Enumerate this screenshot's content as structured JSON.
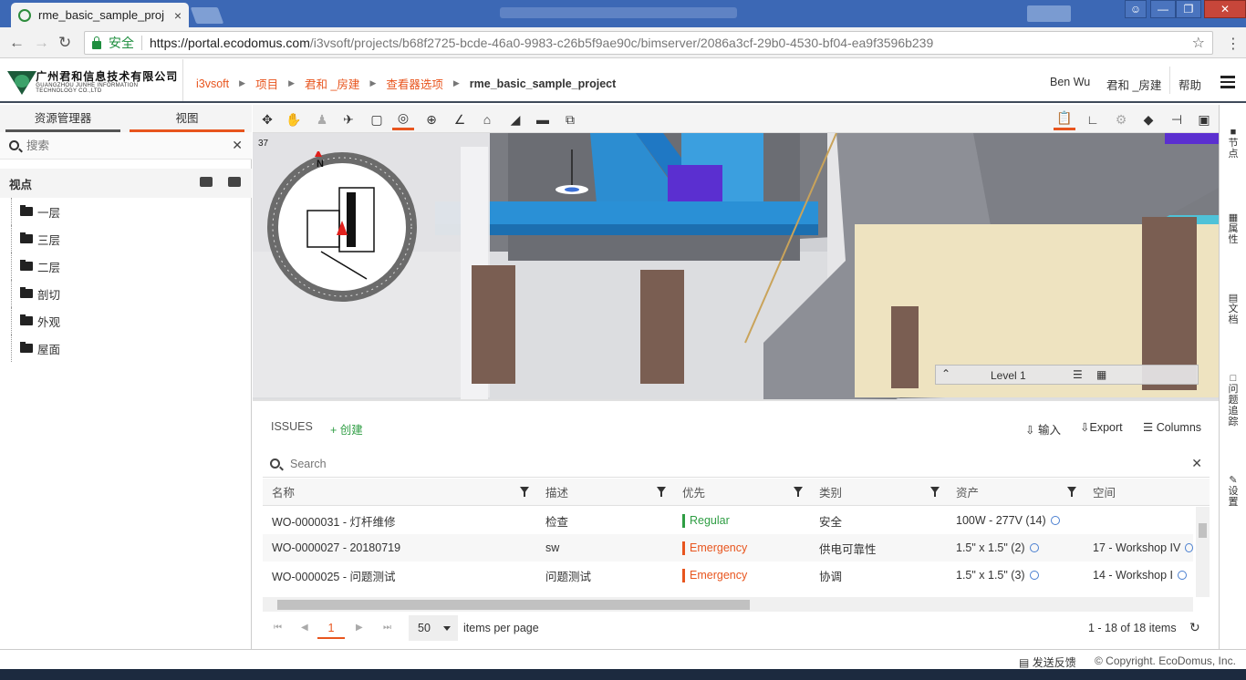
{
  "browser": {
    "tab_title": "rme_basic_sample_proj",
    "tab_close": "×",
    "secure_label": "安全",
    "url_host": "https://portal.ecodomus.com",
    "url_path": "/i3vsoft/projects/b68f2725-bcde-46a0-9983-c26b5f9ae90c/bimserver/2086a3cf-29b0-4530-bf04-ea9f3596b239"
  },
  "header": {
    "logo_cn": "广州君和信息技术有限公司",
    "logo_en": "GUANGZHOU JUNHE INFORMATION TECHNOLOGY CO.,LTD",
    "breadcrumbs": [
      "i3vsoft",
      "项目",
      "君和 _房建",
      "查看器选项",
      "rme_basic_sample_project"
    ],
    "user": "Ben Wu",
    "org": "君和 _房建",
    "help": "帮助"
  },
  "left_panel": {
    "tabs": [
      "资源管理器",
      "视图"
    ],
    "search_placeholder": "搜索",
    "viewpoints_title": "视点",
    "tree": [
      "一层",
      "三层",
      "二层",
      "剖切",
      "外观",
      "屋面"
    ]
  },
  "viewer": {
    "fps": "37",
    "level": "Level 1",
    "compass_n": "N"
  },
  "right_rail": [
    "节点",
    "属性",
    "文档",
    "问题追踪",
    "设置"
  ],
  "issues": {
    "title": "ISSUES",
    "create": "+ 创建",
    "import": "输入",
    "export": "Export",
    "columns": "Columns",
    "search_placeholder": "Search",
    "headers": [
      "名称",
      "描述",
      "优先",
      "类别",
      "资产",
      "空间"
    ],
    "rows": [
      {
        "name": "WO-0000031 - 灯杆维修",
        "desc": "检查",
        "priority": "Regular",
        "category": "安全",
        "asset": "100W - 277V (14)",
        "space": ""
      },
      {
        "name": "WO-0000027 - 20180719",
        "desc": "sw",
        "priority": "Emergency",
        "category": "供电可靠性",
        "asset": "1.5\" x 1.5\" (2)",
        "space": "17 - Workshop IV"
      },
      {
        "name": "WO-0000025 - 问题测试",
        "desc": "问题测试",
        "priority": "Emergency",
        "category": "协调",
        "asset": "1.5\" x 1.5\" (3)",
        "space": "14 - Workshop I"
      }
    ],
    "page": "1",
    "page_size": "50",
    "per_page_label": "items per page",
    "count": "1 - 18 of 18 items"
  },
  "footer": {
    "feedback": "发送反馈",
    "copyright": "© Copyright. EcoDomus, Inc."
  },
  "colors": {
    "accent": "#e8551e",
    "regular": "#2e9d43",
    "emergency": "#e8551e"
  }
}
